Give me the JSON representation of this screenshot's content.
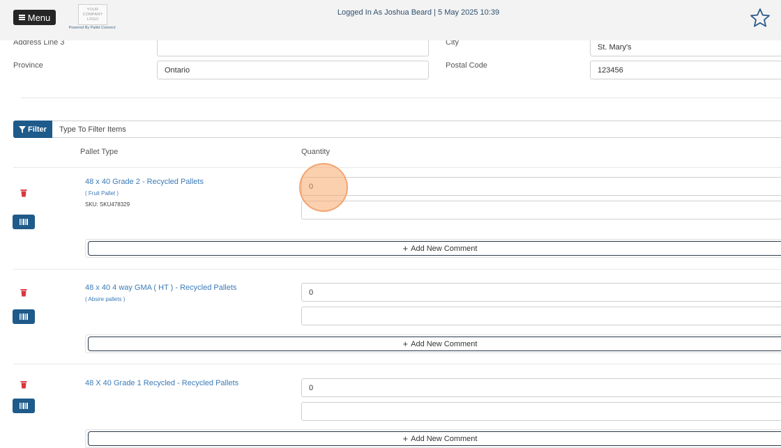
{
  "header": {
    "menu_label": "Menu",
    "logo_lines": [
      "YOUR",
      "COMPANY",
      "LOGO"
    ],
    "powered_by": "Powered By Pallet Connect",
    "status": "Logged In As Joshua Beard | 5 May 2025 10:39"
  },
  "address": {
    "address_line_3_label": "Address Line 3",
    "address_line_3_value": "",
    "city_label": "City",
    "city_value": "St. Mary's",
    "province_label": "Province",
    "province_value": "Ontario",
    "postal_code_label": "Postal Code",
    "postal_code_value": "123456"
  },
  "filter": {
    "button_label": "Filter",
    "placeholder": "Type To Filter Items"
  },
  "columns": {
    "pallet_type": "Pallet Type",
    "quantity": "Quantity"
  },
  "items": [
    {
      "name": "48 x 40 Grade 2 - Recycled Pallets",
      "subtitle": "( Fruit Pallet )",
      "sku": "SKU: SKU478329",
      "quantity": "0",
      "comment": "",
      "add_comment_label": "Add New Comment"
    },
    {
      "name": "48 x 40 4 way GMA ( HT ) - Recycled Pallets",
      "subtitle": "( Absire pallets )",
      "sku": "",
      "quantity": "0",
      "comment": "",
      "add_comment_label": "Add New Comment"
    },
    {
      "name": "48 X 40 Grade 1 Recycled - Recycled Pallets",
      "subtitle": "",
      "sku": "",
      "quantity": "0",
      "comment": "",
      "add_comment_label": "Add New Comment"
    }
  ],
  "colors": {
    "header_bg": "#f3f3f3",
    "menu_button_bg": "#252525",
    "primary_blue": "#1e5a8a",
    "link_blue": "#3a7ab8",
    "trash_red": "#d9363e",
    "click_highlight": "#f7aa6e"
  },
  "icons": {
    "menu": "hamburger-icon",
    "favorite": "star-icon",
    "filter": "funnel-icon",
    "delete": "trash-icon",
    "barcode": "barcode-icon",
    "add": "plus-icon"
  }
}
